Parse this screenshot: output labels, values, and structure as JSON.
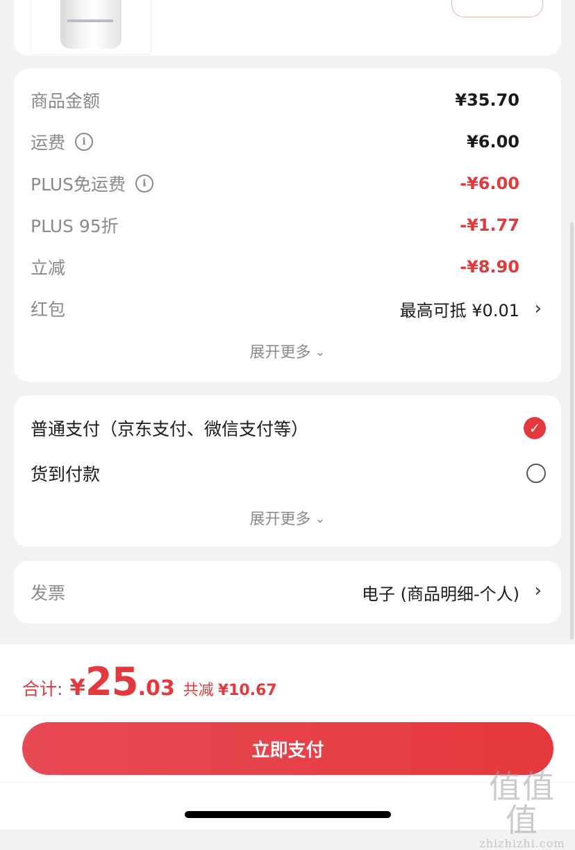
{
  "summary": {
    "rows": [
      {
        "label": "商品金额",
        "value": "¥35.70"
      },
      {
        "label": "运费",
        "value": "¥6.00"
      },
      {
        "label": "PLUS免运费",
        "value": "-¥6.00"
      },
      {
        "label": "PLUS 95折",
        "value": "-¥1.77"
      },
      {
        "label": "立减",
        "value": "-¥8.90"
      },
      {
        "label": "红包",
        "value": "最高可抵 ¥0.01"
      }
    ],
    "expand_label": "展开更多"
  },
  "payment": {
    "options": [
      {
        "label": "普通支付（京东支付、微信支付等）",
        "selected": true
      },
      {
        "label": "货到付款",
        "selected": false
      }
    ],
    "expand_label": "展开更多"
  },
  "invoice": {
    "label": "发票",
    "value": "电子 (商品明细-个人)"
  },
  "footer": {
    "total_label": "合计:",
    "currency": "¥",
    "total_integer": "25",
    "total_decimal": ".03",
    "saved_label": "共减",
    "saved_value": "¥10.67",
    "pay_button": "立即支付"
  },
  "watermark": {
    "glyphs": "值值值",
    "site": "zhizhizhi.com"
  },
  "colors": {
    "accent": "#e4393c",
    "background": "#f2f2f2",
    "card": "#ffffff"
  },
  "icons": {
    "info": "info-icon",
    "chevron": "chevron-right-icon",
    "expand": "chevron-down-icon",
    "check": "check-icon"
  }
}
